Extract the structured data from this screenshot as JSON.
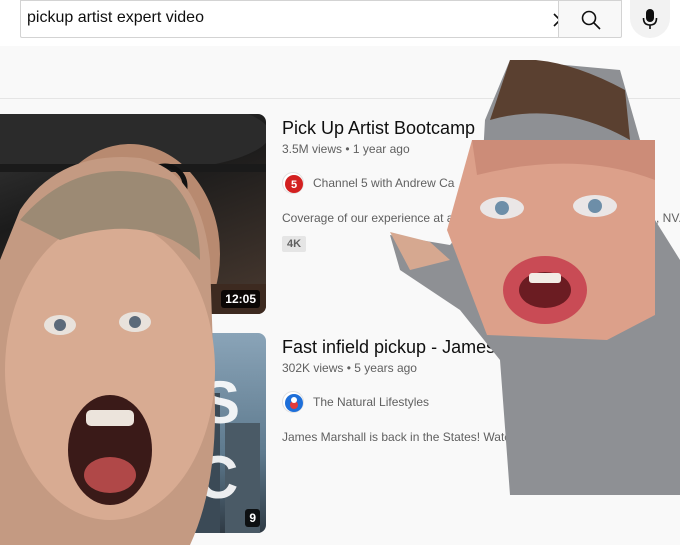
{
  "search": {
    "query": "pickup artist expert video"
  },
  "icons": {
    "clear": "close-icon",
    "search": "search-icon",
    "mic": "microphone-icon"
  },
  "results": [
    {
      "title": "Pick Up Artist Bootcamp",
      "views": "3.5M views",
      "age": "1 year ago",
      "channel": "Channel 5 with Andrew Ca",
      "description": "Coverage of our experience at a",
      "description_tail": ", NV.",
      "badge": "4K",
      "duration": "12:05"
    },
    {
      "title": "Fast infield pickup - James",
      "views": "302K views",
      "age": "5 years ago",
      "channel": "The Natural Lifestyles",
      "description": "James Marshall is back in the States! Watch",
      "duration": "9"
    }
  ],
  "colors": {
    "text_primary": "#0f0f0f",
    "text_secondary": "#606060",
    "channel5_red": "#d32020",
    "natural_blue": "#1e6fd9"
  }
}
